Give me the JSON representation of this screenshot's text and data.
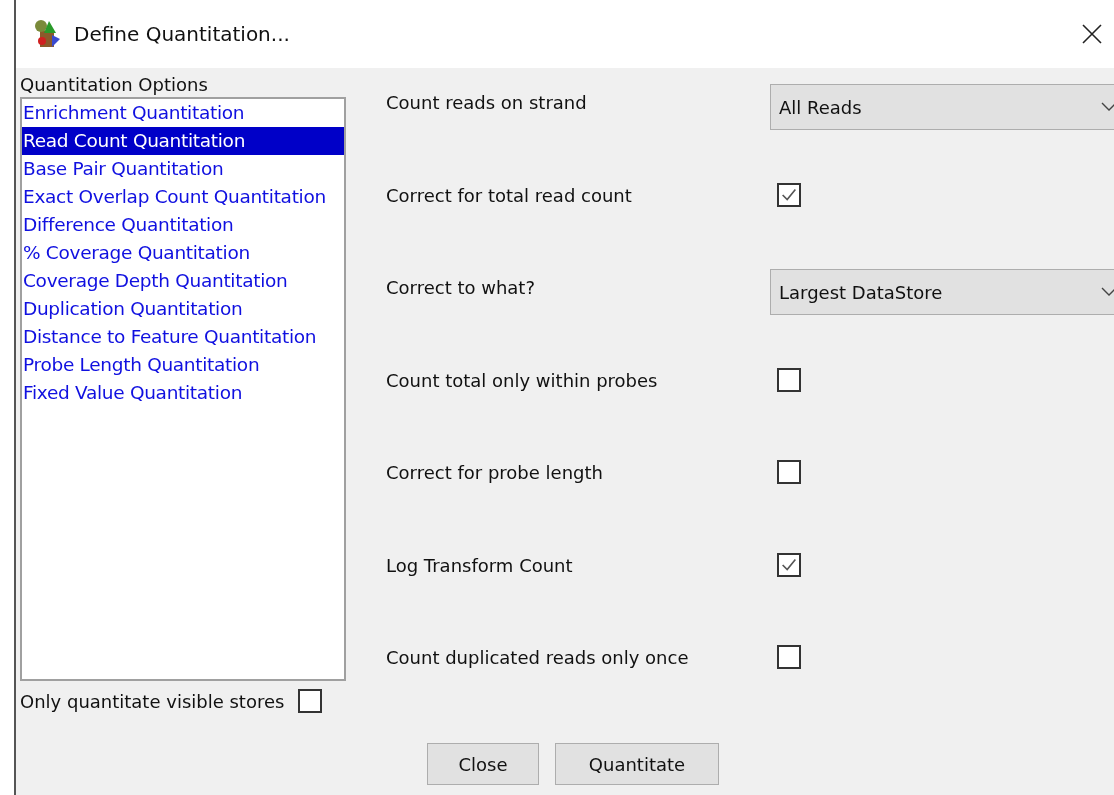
{
  "window": {
    "title": "Define Quantitation..."
  },
  "options": {
    "label": "Quantitation Options",
    "items": [
      {
        "label": "Enrichment Quantitation",
        "selected": false
      },
      {
        "label": "Read Count Quantitation",
        "selected": true
      },
      {
        "label": "Base Pair Quantitation",
        "selected": false
      },
      {
        "label": "Exact Overlap Count Quantitation",
        "selected": false
      },
      {
        "label": "Difference Quantitation",
        "selected": false
      },
      {
        "label": "% Coverage Quantitation",
        "selected": false
      },
      {
        "label": "Coverage Depth Quantitation",
        "selected": false
      },
      {
        "label": "Duplication Quantitation",
        "selected": false
      },
      {
        "label": "Distance to Feature Quantitation",
        "selected": false
      },
      {
        "label": "Probe Length Quantitation",
        "selected": false
      },
      {
        "label": "Fixed Value Quantitation",
        "selected": false
      }
    ]
  },
  "visible_only": {
    "label": "Only quantitate visible stores",
    "checked": false
  },
  "settings": [
    {
      "kind": "dropdown",
      "label": "Count reads on strand",
      "value": "All Reads"
    },
    {
      "kind": "checkbox",
      "label": "Correct for total read count",
      "checked": true
    },
    {
      "kind": "dropdown",
      "label": "Correct to what?",
      "value": "Largest DataStore"
    },
    {
      "kind": "checkbox",
      "label": "Count total only within probes",
      "checked": false
    },
    {
      "kind": "checkbox",
      "label": "Correct for probe length",
      "checked": false
    },
    {
      "kind": "checkbox",
      "label": "Log Transform Count",
      "checked": true
    },
    {
      "kind": "checkbox",
      "label": "Count duplicated reads only once",
      "checked": false
    }
  ],
  "buttons": [
    "Close",
    "Quantitate"
  ]
}
